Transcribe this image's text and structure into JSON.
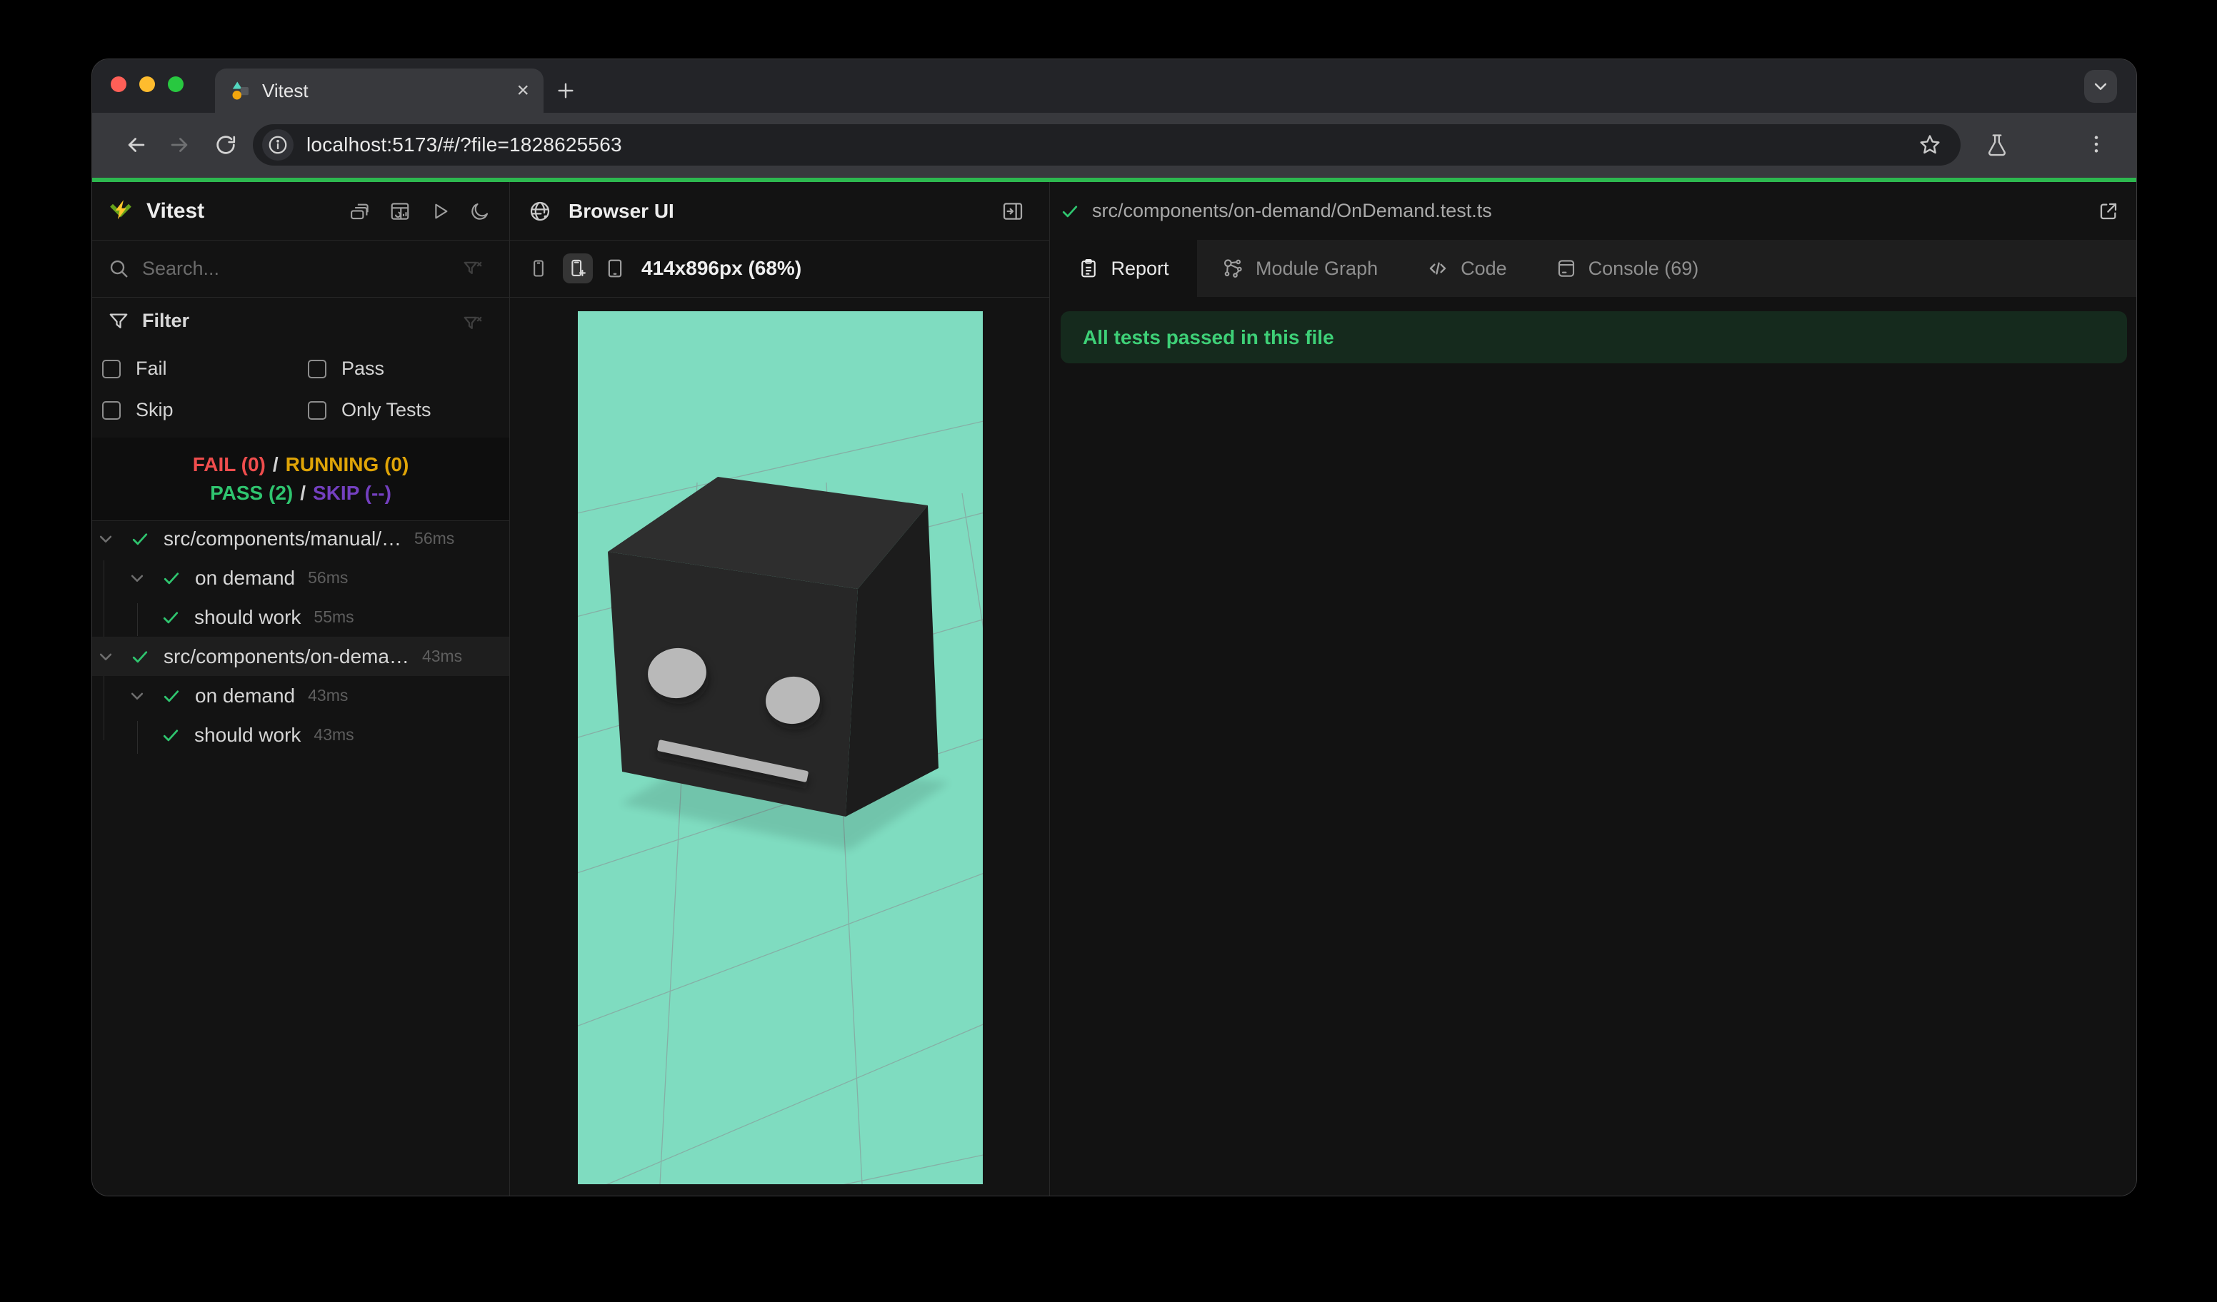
{
  "browser_chrome": {
    "tab": {
      "title": "Vitest",
      "close_glyph": "×"
    },
    "new_tab_glyph": "+",
    "url": "localhost:5173/#/?file=1828625563",
    "traffic_light_colors": {
      "close": "#ff5f57",
      "minimize": "#febc2e",
      "zoom": "#28c840"
    }
  },
  "app": {
    "accent_green": "#2db84f",
    "sidebar": {
      "title": "Vitest",
      "search_placeholder": "Search...",
      "filter": {
        "title": "Filter",
        "options": [
          {
            "label": "Fail",
            "checked": false
          },
          {
            "label": "Pass",
            "checked": false
          },
          {
            "label": "Skip",
            "checked": false
          },
          {
            "label": "Only Tests",
            "checked": false
          }
        ]
      },
      "status": {
        "fail": "FAIL (0)",
        "running": "RUNNING (0)",
        "pass": "PASS (2)",
        "skip": "SKIP (--)",
        "sep": "/",
        "colors": {
          "fail": "#ef4d4d",
          "running": "#dfa407",
          "pass": "#2fc56f",
          "skip": "#7440c0"
        }
      },
      "tree": [
        {
          "name": "src/components/manual/…",
          "duration": "56ms",
          "level": 0,
          "type": "file"
        },
        {
          "name": "on demand",
          "duration": "56ms",
          "level": 1,
          "type": "suite"
        },
        {
          "name": "should work",
          "duration": "55ms",
          "level": 2,
          "type": "test"
        },
        {
          "name": "src/components/on-dema…",
          "duration": "43ms",
          "level": 0,
          "type": "file",
          "selected": true
        },
        {
          "name": "on demand",
          "duration": "43ms",
          "level": 1,
          "type": "suite"
        },
        {
          "name": "should work",
          "duration": "43ms",
          "level": 2,
          "type": "test"
        }
      ]
    },
    "preview": {
      "title": "Browser UI",
      "viewport_label": "414x896px (68%)",
      "scene": {
        "background": "#7fdcc0",
        "object": "dark robot cube on grid floor"
      }
    },
    "report": {
      "file_path": "src/components/on-demand/OnDemand.test.ts",
      "tabs": [
        {
          "label": "Report",
          "active": true
        },
        {
          "label": "Module Graph",
          "active": false
        },
        {
          "label": "Code",
          "active": false
        },
        {
          "label": "Console (69)",
          "active": false
        }
      ],
      "banner": "All tests passed in this file"
    }
  }
}
